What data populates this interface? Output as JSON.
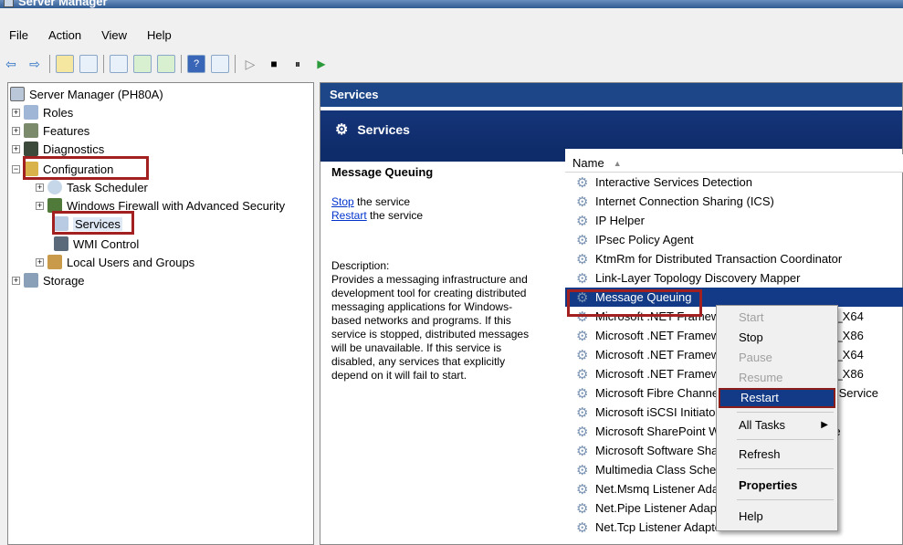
{
  "window": {
    "title": "Server Manager"
  },
  "menu": [
    "File",
    "Action",
    "View",
    "Help"
  ],
  "toolbar": {
    "icons": [
      "back-arrow-icon",
      "forward-arrow-icon",
      "up-folder-icon",
      "show-tree-icon",
      "properties-icon",
      "refresh-icon",
      "export-icon",
      "help-icon",
      "view-icon",
      "start-service-icon",
      "stop-service-icon",
      "pause-service-icon",
      "resume-service-icon"
    ],
    "glyphs": {
      "back": "⇦",
      "forward": "⇨",
      "play": "▷",
      "stop": "■",
      "pause": "⏸",
      "resume": "▶"
    }
  },
  "tree": {
    "root": "Server Manager (PH80A)",
    "roles": "Roles",
    "features": "Features",
    "diagnostics": "Diagnostics",
    "configuration": "Configuration",
    "task_scheduler": "Task Scheduler",
    "firewall": "Windows Firewall with Advanced Security",
    "services": "Services",
    "wmi": "WMI Control",
    "local_users": "Local Users and Groups",
    "storage": "Storage"
  },
  "right": {
    "header": "Services",
    "banner": "Services",
    "detail": {
      "service_name": "Message Queuing",
      "stop_link": "Stop",
      "stop_suffix": " the service",
      "restart_link": "Restart",
      "restart_suffix": " the service",
      "desc_label": "Description:",
      "desc_lines": [
        "Provides a messaging infrastructure and",
        "development tool for creating distributed",
        "messaging applications for Windows-",
        "based networks and programs. If this",
        "service is stopped, distributed messages",
        "will be unavailable. If this service is",
        "disabled, any services that explicitly",
        "depend on it will fail to start."
      ]
    },
    "list_header": "Name",
    "sort_glyph": "▲",
    "rows": [
      "Interactive Services Detection",
      "Internet Connection Sharing (ICS)",
      "IP Helper",
      "IPsec Policy Agent",
      "KtmRm for Distributed Transaction Coordinator",
      "Link-Layer Topology Discovery Mapper",
      "Message Queuing",
      "Microsoft .NET Framework NGEN v2.0.50727_X64",
      "Microsoft .NET Framework NGEN v2.0.50727_X86",
      "Microsoft .NET Framework NGEN v4.0.30319_X64",
      "Microsoft .NET Framework NGEN v4.0.30319_X86",
      "Microsoft Fibre Channel Platform Registration Service",
      "Microsoft iSCSI Initiator Service",
      "Microsoft SharePoint Workspace Audit Service",
      "Microsoft Software Shadow Copy Provider",
      "Multimedia Class Scheduler",
      "Net.Msmq Listener Adapter",
      "Net.Pipe Listener Adapter",
      "Net.Tcp Listener Adapter"
    ],
    "selected_index": 6
  },
  "context_menu": {
    "start": "Start",
    "stop": "Stop",
    "pause": "Pause",
    "resume": "Resume",
    "restart": "Restart",
    "all_tasks": "All Tasks",
    "refresh": "Refresh",
    "properties": "Properties",
    "help": "Help",
    "submenu_glyph": "▶"
  },
  "colors": {
    "selection": "#123a86",
    "highlight_box": "#a32020",
    "header_bar": "#1c4687"
  }
}
